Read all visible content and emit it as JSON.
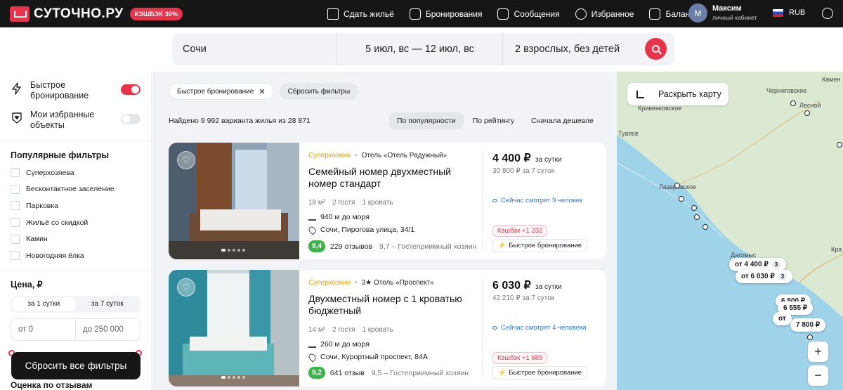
{
  "header": {
    "logo_text": "СУТОЧНО.РУ",
    "cashback_pill": "КЭШБЭК 30%",
    "nav": [
      {
        "label": "Сдать жильё",
        "icon": "house-icon"
      },
      {
        "label": "Бронирования",
        "icon": "suitcase-icon"
      },
      {
        "label": "Сообщения",
        "icon": "chat-icon"
      },
      {
        "label": "Избранное",
        "icon": "heart-icon"
      },
      {
        "label": "Баланс",
        "icon": "wallet-icon"
      }
    ],
    "user": {
      "initial": "М",
      "name": "Максим",
      "subtitle": "личный кабинет"
    },
    "currency": "RUB"
  },
  "search": {
    "city": "Сочи",
    "dates": "5 июл, вс — 12 июл, вс",
    "guests": "2 взрослых, без детей"
  },
  "sidebar": {
    "instant_booking": {
      "label": "Быстрое бронирование",
      "on": true
    },
    "favorites": {
      "label": "Мои избранные объекты",
      "on": false
    },
    "popular_heading": "Популярные фильтры",
    "popular": [
      "Суперхозяева",
      "Бесконтактное заселение",
      "Парковка",
      "Жильё со скидкой",
      "Камин",
      "Новогодняя ёлка"
    ],
    "price_heading": "Цена, ₽",
    "price_tabs": [
      "за 1 сутки",
      "за 7 суток"
    ],
    "price_from": "от 0",
    "price_to": "до 250 000",
    "reset_all": "Сбросить все фильтры",
    "rating_heading": "Оценка по отзывам"
  },
  "listing": {
    "chips": [
      {
        "label": "Быстрое бронирование",
        "removable": true
      },
      {
        "label": "Сбросить фильтры",
        "removable": false
      }
    ],
    "found": "Найдено 9 992 варианта жилья из 28 871",
    "sorts": [
      "По популярности",
      "По рейтингу",
      "Сначала дешевле"
    ],
    "cards": [
      {
        "host": "Суперхозяин",
        "hotel": "Отель «Отель Радужный»",
        "title": "Семейный номер двухместный номер стандарт",
        "area": "18 м²",
        "guests": "2 гостя",
        "beds": "1 кровать",
        "sea": "940 м до моря",
        "address": "Сочи, Пирогова улица, 34/1",
        "score": "9,4",
        "reviews": "229 отзывов",
        "host_score": "9,7 – Гостеприимный хозяин",
        "price": "4 400 ₽",
        "price_unit": "за сутки",
        "price_total": "30 800 ₽ за 7 суток",
        "watching": "Сейчас смотрят 9 человек",
        "cashback": "Кэшбэк +1 232",
        "instant": "Быстрое бронирование"
      },
      {
        "host": "Суперхозяин",
        "hotel": "3★ Отель «Проспект»",
        "title": "Двухместный номер с 1 кроватью бюджетный",
        "area": "14 м²",
        "guests": "2 гостя",
        "beds": "1 кровать",
        "sea": "260 м до моря",
        "address": "Сочи, Курортный проспект, 84А",
        "score": "9,2",
        "reviews": "641 отзыв",
        "host_score": "9,5 – Гостеприимный хозяин",
        "price": "6 030 ₽",
        "price_unit": "за сутки",
        "price_total": "42 210 ₽ за 7 суток",
        "watching": "Сейчас смотрят 4 человека",
        "cashback": "Кэшбэк +1 689",
        "instant": "Быстрое бронирование"
      }
    ]
  },
  "map": {
    "expand_label": "Раскрыть карту",
    "cities": [
      "Черниговское",
      "Кривенковское",
      "Туапсе",
      "Лазаревское",
      "Дагомыс",
      "Лесной",
      "Камен",
      "Кра"
    ],
    "pins": [
      {
        "label": "от 4 400 ₽",
        "count": "3"
      },
      {
        "label": "от 6 030 ₽",
        "count": "3"
      },
      {
        "label": "6 500 ₽"
      },
      {
        "label": "6 555 ₽"
      },
      {
        "label": "от"
      },
      {
        "label": "7 800 ₽"
      }
    ],
    "zoom_in": "+",
    "zoom_out": "−",
    "colors": {
      "land": "#dbe8d2",
      "sea": "#9fd3ea",
      "accent": "#e8334a"
    }
  }
}
